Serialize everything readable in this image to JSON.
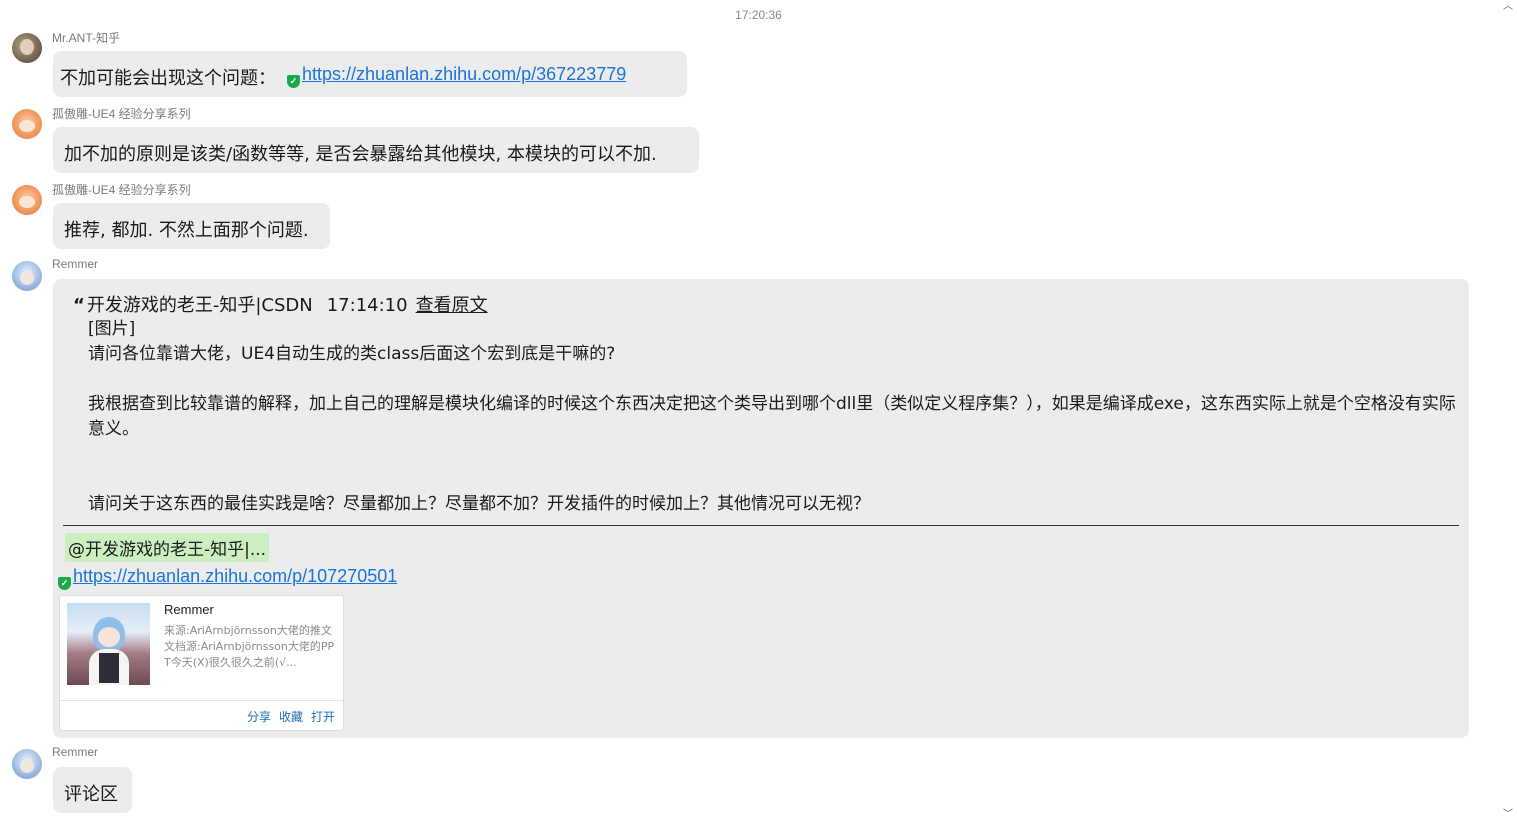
{
  "chat": {
    "timestamp": "17:20:36",
    "messages": [
      {
        "sender": "Mr.ANT-知乎",
        "text": "不加可能会出现这个问题：",
        "link": "https://zhuanlan.zhihu.com/p/367223779"
      },
      {
        "sender": "孤傲雕-UE4 经验分享系列",
        "text": "加不加的原则是该类/函数等等, 是否会暴露给其他模块, 本模块的可以不加."
      },
      {
        "sender": "孤傲雕-UE4 经验分享系列",
        "text": "推荐, 都加. 不然上面那个问题."
      },
      {
        "sender": "Remmer",
        "quote": {
          "open_mark": "“",
          "author": "开发游戏的老王-知乎|CSDN",
          "time": "17:14:10",
          "view_original": "查看原文",
          "lines": [
            "[图片]",
            "请问各位靠谱大佬，UE4自动生成的类class后面这个宏到底是干嘛的?",
            "我根据查到比较靠谱的解释，加上自己的理解是模块化编译的时候这个东西决定把这个类导出到哪个dll里（类似定义程序集？），如果是编译成exe，这东西实际上就是个空格没有实际意义。",
            "请问关于这东西的最佳实践是啥？尽量都加上？尽量都不加？开发插件的时候加上？其他情况可以无视？"
          ]
        },
        "mention": "@开发游戏的老王-知乎|...",
        "link": "https://zhuanlan.zhihu.com/p/107270501",
        "card": {
          "title": "Remmer",
          "description": "来源:AriArnbjörnsson大佬的推文文档源:AriArnbjörnsson大佬的PPT今天(X)很久很久之前(√...",
          "actions": [
            "分享",
            "收藏",
            "打开"
          ]
        }
      },
      {
        "sender": "Remmer",
        "text": "评论区"
      }
    ]
  },
  "icons": {
    "link_badge": "shield-check-icon",
    "scroll_up": "chevron-up-icon",
    "scroll_down": "chevron-down-icon"
  },
  "colors": {
    "bubble_bg": "#ececec",
    "link": "#1a73d9",
    "mention_bg": "#cdeec0",
    "badge": "#1aa84a",
    "card_action": "#1a6fb8"
  }
}
